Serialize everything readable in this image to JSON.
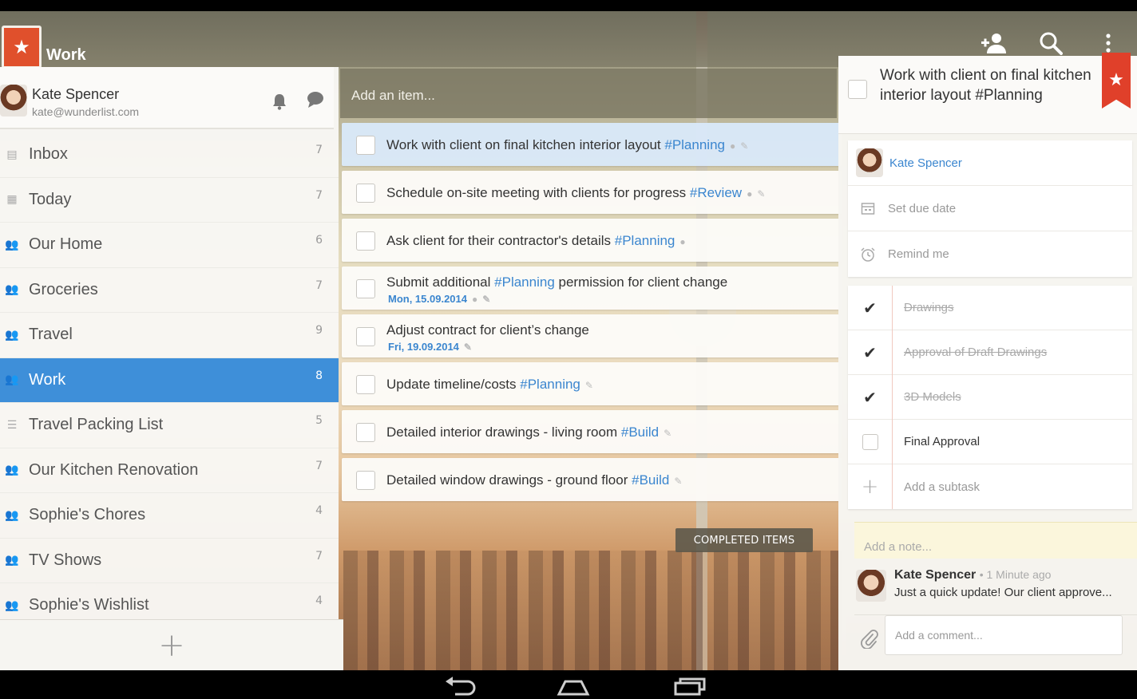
{
  "app": {
    "title": "Work"
  },
  "profile": {
    "name": "Kate Spencer",
    "email": "kate@wunderlist.com"
  },
  "lists": [
    {
      "label": "Inbox",
      "count": "7",
      "icon": "inbox-icon"
    },
    {
      "label": "Today",
      "count": "7",
      "icon": "calendar-icon"
    },
    {
      "label": "Our Home",
      "count": "6",
      "icon": "people-icon"
    },
    {
      "label": "Groceries",
      "count": "7",
      "icon": "people-icon"
    },
    {
      "label": "Travel",
      "count": "9",
      "icon": "people-icon"
    },
    {
      "label": "Work",
      "count": "8",
      "icon": "people-icon",
      "active": true
    },
    {
      "label": "Travel Packing List",
      "count": "5",
      "icon": "list-icon"
    },
    {
      "label": "Our Kitchen Renovation",
      "count": "7",
      "icon": "people-icon"
    },
    {
      "label": "Sophie's Chores",
      "count": "4",
      "icon": "people-icon"
    },
    {
      "label": "TV Shows",
      "count": "7",
      "icon": "people-icon"
    },
    {
      "label": "Sophie's Wishlist",
      "count": "4",
      "icon": "people-icon"
    }
  ],
  "add_item_placeholder": "Add an item...",
  "tasks": [
    {
      "text": "Work with client on final kitchen interior layout",
      "tag": "#Planning",
      "date": "",
      "selected": true,
      "note": true
    },
    {
      "text": "Schedule on-site meeting with clients for progress",
      "tag": "#Review",
      "date": "",
      "note": true
    },
    {
      "text": "Ask client for their contractor's details",
      "tag": "#Planning",
      "date": "",
      "note": true,
      "no_pin": true
    },
    {
      "text": "Submit additional",
      "tag": "#Planning",
      "after": "permission for client change",
      "date": "Mon, 15.09.2014",
      "note": true
    },
    {
      "text": "Adjust contract for client’s change",
      "tag": "",
      "date": "Fri, 19.09.2014"
    },
    {
      "text": "Update timeline/costs",
      "tag": "#Planning",
      "date": ""
    },
    {
      "text": "Detailed interior drawings - living room",
      "tag": "#Build",
      "date": ""
    },
    {
      "text": "Detailed window drawings - ground floor",
      "tag": "#Build",
      "date": ""
    }
  ],
  "completed_label": "COMPLETED ITEMS",
  "detail": {
    "title": "Work with client on final kitchen interior layout #Planning",
    "assignee": "Kate Spencer",
    "due_label": "Set due date",
    "remind_label": "Remind me",
    "subtasks": [
      {
        "label": "Drawings",
        "done": true
      },
      {
        "label": "Approval of Draft Drawings",
        "done": true
      },
      {
        "label": "3D Models",
        "done": true
      },
      {
        "label": "Final Approval",
        "done": false
      }
    ],
    "add_subtask_label": "Add a subtask",
    "note_placeholder": "Add a note...",
    "comment": {
      "author": "Kate Spencer",
      "time": "• 1 Minute ago",
      "text": "Just a quick update! Our client approve..."
    },
    "comment_placeholder": "Add a comment..."
  },
  "colors": {
    "accent": "#3e8fd9",
    "brand": "#e0502c",
    "tag": "#3b86cf"
  }
}
